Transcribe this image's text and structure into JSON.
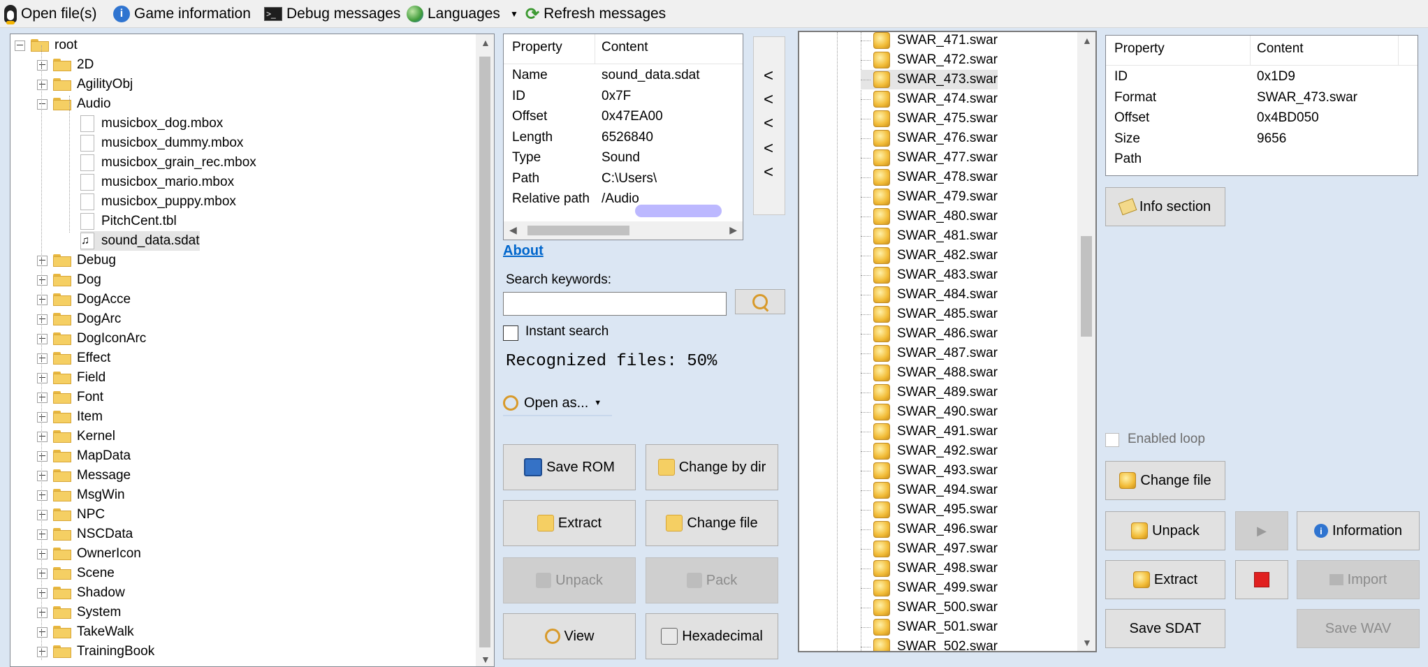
{
  "toolbar": {
    "open_files": "Open file(s)",
    "game_info": "Game information",
    "debug": "Debug messages",
    "languages": "Languages",
    "refresh": "Refresh messages"
  },
  "tree": {
    "root": "root",
    "items": [
      "2D",
      "AgilityObj",
      "Audio",
      "musicbox_dog.mbox",
      "musicbox_dummy.mbox",
      "musicbox_grain_rec.mbox",
      "musicbox_mario.mbox",
      "musicbox_puppy.mbox",
      "PitchCent.tbl",
      "sound_data.sdat",
      "Debug",
      "Dog",
      "DogAcce",
      "DogArc",
      "DogIconArc",
      "Effect",
      "Field",
      "Font",
      "Item",
      "Kernel",
      "MapData",
      "Message",
      "MsgWin",
      "NPC",
      "NSCData",
      "OwnerIcon",
      "Scene",
      "Shadow",
      "System",
      "TakeWalk",
      "TrainingBook"
    ]
  },
  "props1": {
    "col_property": "Property",
    "col_content": "Content",
    "rows": [
      {
        "k": "Name",
        "v": "sound_data.sdat"
      },
      {
        "k": "ID",
        "v": "0x7F"
      },
      {
        "k": "Offset",
        "v": "0x47EA00"
      },
      {
        "k": "Length",
        "v": "6526840"
      },
      {
        "k": "Type",
        "v": "Sound"
      },
      {
        "k": "Path",
        "v": "C:\\Users\\"
      },
      {
        "k": "Relative path",
        "v": "/Audio"
      }
    ]
  },
  "nav": {
    "back_arrow": "<"
  },
  "middle": {
    "about": "About",
    "search_label": "Search keywords:",
    "search_value": "",
    "instant_search": "Instant search",
    "recognized": "Recognized files: 50%",
    "open_as": "Open as...",
    "save_rom": "Save ROM",
    "change_by_dir": "Change by dir",
    "extract": "Extract",
    "change_file": "Change file",
    "unpack": "Unpack",
    "pack": "Pack",
    "view": "View",
    "hexadecimal": "Hexadecimal"
  },
  "files": [
    "SWAR_471.swar",
    "SWAR_472.swar",
    "SWAR_473.swar",
    "SWAR_474.swar",
    "SWAR_475.swar",
    "SWAR_476.swar",
    "SWAR_477.swar",
    "SWAR_478.swar",
    "SWAR_479.swar",
    "SWAR_480.swar",
    "SWAR_481.swar",
    "SWAR_482.swar",
    "SWAR_483.swar",
    "SWAR_484.swar",
    "SWAR_485.swar",
    "SWAR_486.swar",
    "SWAR_487.swar",
    "SWAR_488.swar",
    "SWAR_489.swar",
    "SWAR_490.swar",
    "SWAR_491.swar",
    "SWAR_492.swar",
    "SWAR_493.swar",
    "SWAR_494.swar",
    "SWAR_495.swar",
    "SWAR_496.swar",
    "SWAR_497.swar",
    "SWAR_498.swar",
    "SWAR_499.swar",
    "SWAR_500.swar",
    "SWAR_501.swar",
    "SWAR_502.swar"
  ],
  "props2": {
    "col_property": "Property",
    "col_content": "Content",
    "rows": [
      {
        "k": "ID",
        "v": "0x1D9"
      },
      {
        "k": "Format",
        "v": "SWAR_473.swar"
      },
      {
        "k": "Offset",
        "v": "0x4BD050"
      },
      {
        "k": "Size",
        "v": "9656"
      },
      {
        "k": "Path",
        "v": ""
      }
    ]
  },
  "right": {
    "info_section": "Info section",
    "enabled_loop": "Enabled loop",
    "change_file": "Change file",
    "unpack": "Unpack",
    "information": "Information",
    "extract": "Extract",
    "import": "Import",
    "save_sdat": "Save SDAT",
    "save_wav": "Save WAV"
  },
  "colors": {
    "accent": "#0066cc",
    "stop": "#e02020",
    "panel": "#dbe6f3"
  }
}
